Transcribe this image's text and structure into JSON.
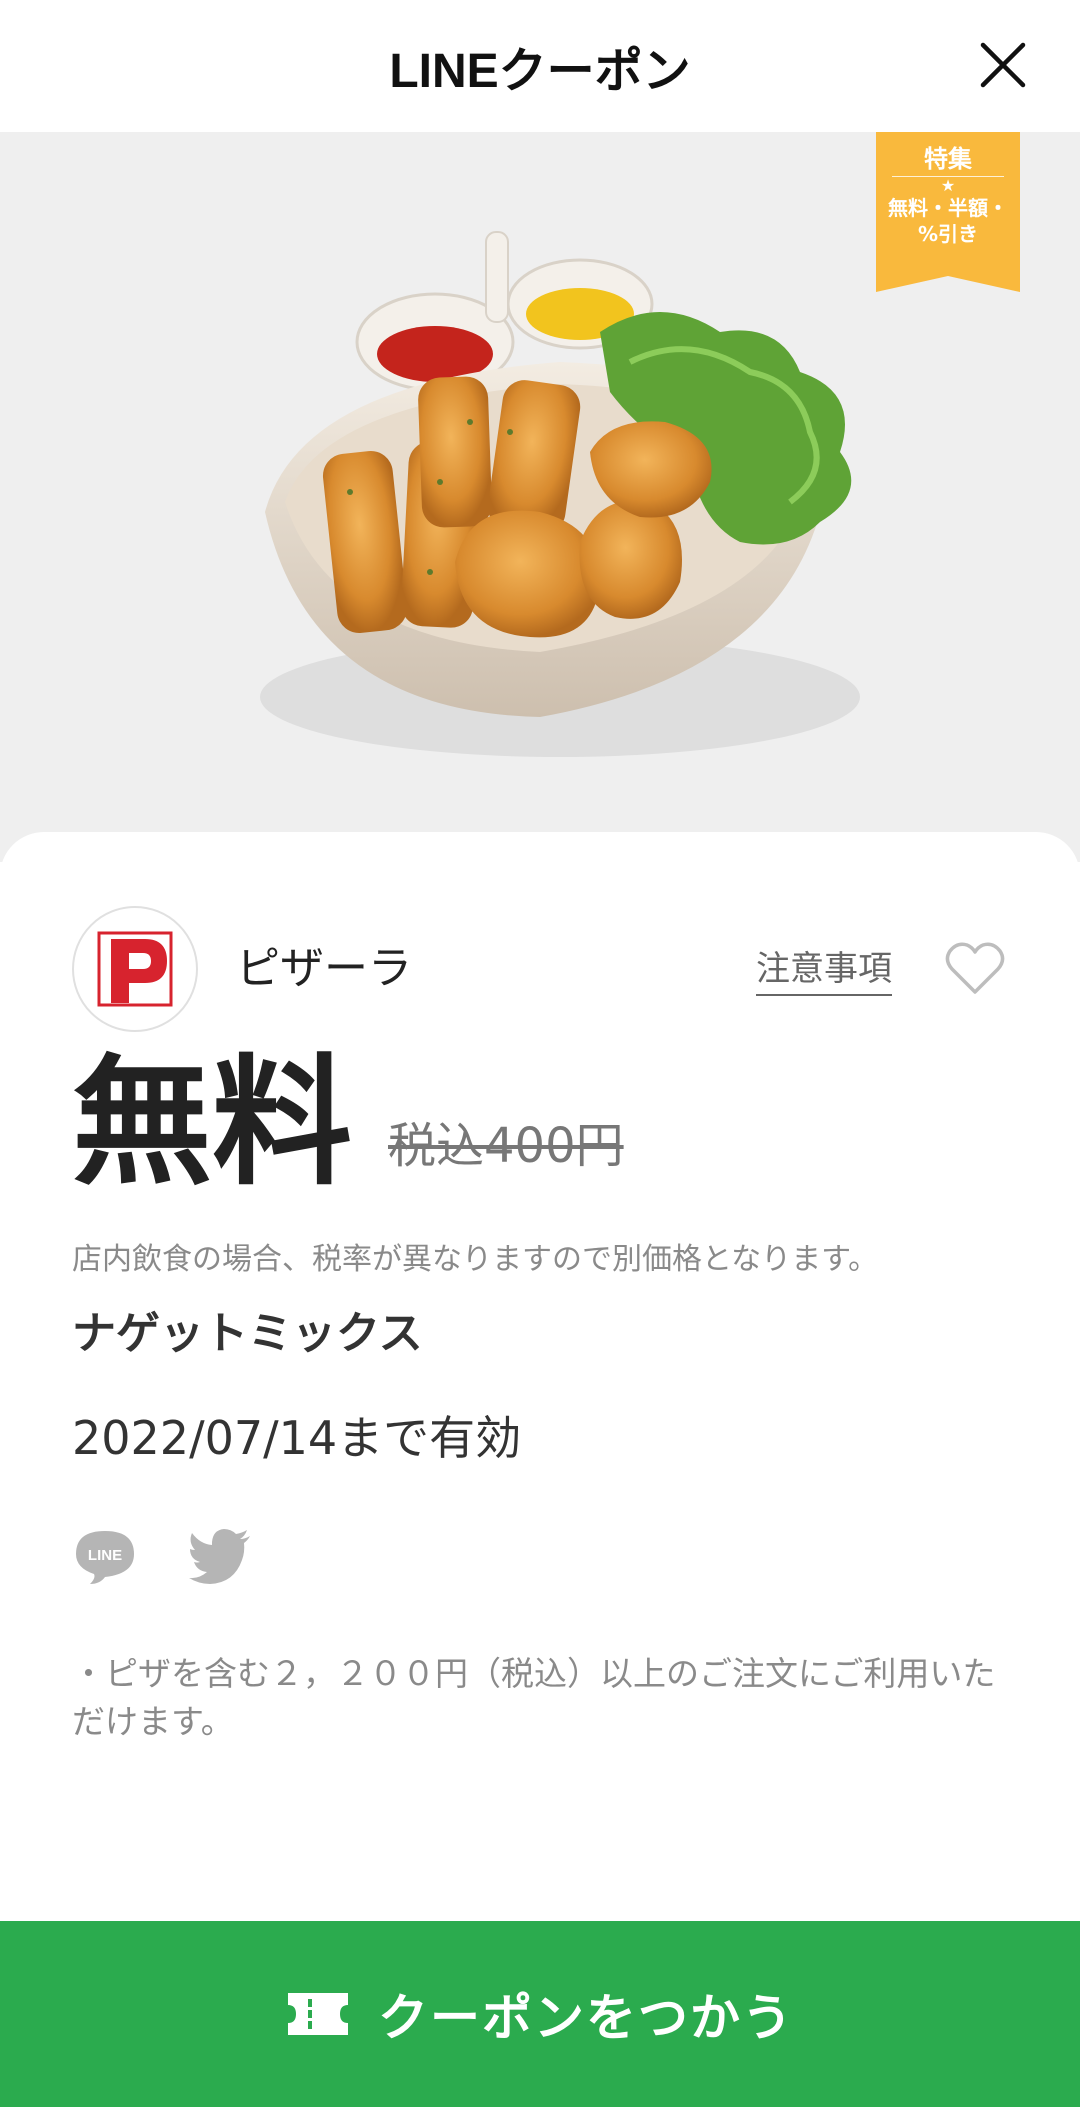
{
  "header": {
    "title": "LINEクーポン",
    "close_icon": "close-icon"
  },
  "hero": {
    "badge": {
      "title": "特集",
      "star": "★",
      "text": "無料・半額・%引き"
    },
    "image_subject": "nugget-mix-plate"
  },
  "shop": {
    "name": "ピザーラ",
    "notes_link": "注意事項",
    "favorite_icon": "heart-outline-icon"
  },
  "price": {
    "main": "無料",
    "original": "税込400円"
  },
  "tax_note": "店内飲食の場合、税率が異なりますので別価格となります。",
  "item_name": "ナゲットミックス",
  "valid_until": "2022/07/14まで有効",
  "share": {
    "line_label": "LINE",
    "line_icon": "line-share-icon",
    "twitter_icon": "twitter-icon"
  },
  "condition": "・ピザを含む２，２００円（税込）以上のご注文にご利用いただけます。",
  "cta": {
    "label": "クーポンをつかう",
    "icon": "ticket-icon"
  },
  "colors": {
    "accent_green": "#2bab4e",
    "badge_orange": "#f9b93d",
    "logo_red": "#d7232e"
  }
}
